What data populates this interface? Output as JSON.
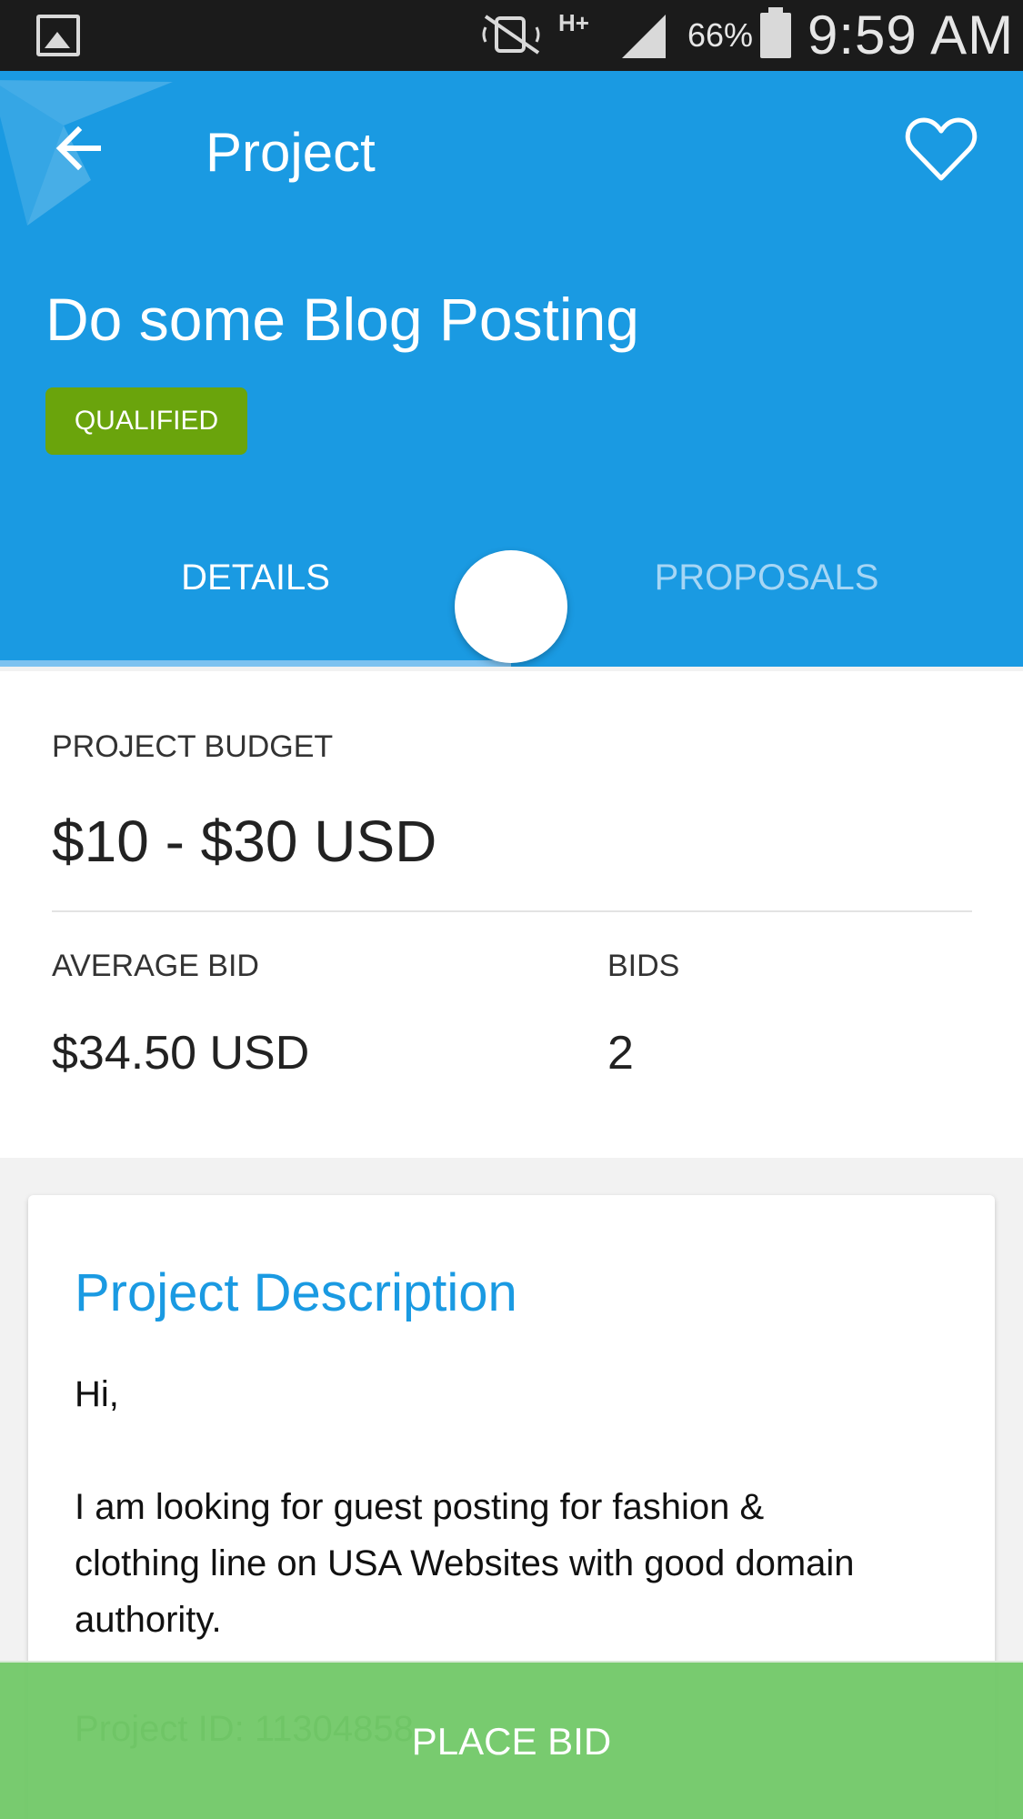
{
  "status_bar": {
    "battery_percent": "66%",
    "time": "9:59 AM",
    "network": "H+"
  },
  "toolbar": {
    "title": "Project"
  },
  "project": {
    "title": "Do some Blog Posting",
    "badge": "QUALIFIED"
  },
  "tabs": [
    {
      "label": "DETAILS",
      "active": true
    },
    {
      "label": "PROPOSALS",
      "active": false
    }
  ],
  "budget": {
    "label": "PROJECT BUDGET",
    "value": "$10 - $30 USD"
  },
  "stats": {
    "average_bid_label": "AVERAGE BID",
    "average_bid_value": "$34.50 USD",
    "bids_label": "BIDS",
    "bids_value": "2"
  },
  "description": {
    "title": "Project Description",
    "lines": [
      "Hi,",
      "I am looking for guest posting for fashion &",
      "clothing line on USA Websites with good domain",
      "authority."
    ],
    "project_id": "Project ID: 11304858"
  },
  "actions": {
    "place_bid": "PLACE BID"
  },
  "colors": {
    "primary": "#1a9ae2",
    "badge": "#6aa40c",
    "place_bid": "#70c866"
  }
}
